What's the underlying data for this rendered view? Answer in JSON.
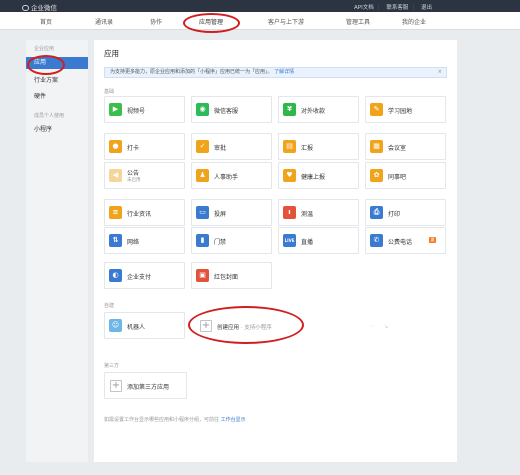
{
  "topbar": {
    "brand": "企业微信",
    "links": [
      "API文档",
      "联系客服",
      "退出"
    ]
  },
  "nav": {
    "items": [
      "首页",
      "通讯录",
      "协作",
      "应用管理",
      "客户与上下游",
      "管理工具",
      "我的企业"
    ],
    "active": "应用管理"
  },
  "sidebar": {
    "group1": "企业应用",
    "items": [
      "应用",
      "行业方案",
      "硬件"
    ],
    "group2": "成员个人使用",
    "items2": [
      "小程序"
    ]
  },
  "main": {
    "title": "应用",
    "notice": "为支持更多能力，原企业应用和添加的「小程序」应用已统一为「应用」。",
    "notice_link": "了解详情",
    "notice_close": "×",
    "basic_title": "基础",
    "apps": [
      {
        "name": "视频号",
        "color": "#3bbf4a",
        "glyph": "▶"
      },
      {
        "name": "微信客服",
        "color": "#2fba5a",
        "glyph": "◉"
      },
      {
        "name": "对外收款",
        "color": "#2fb74a",
        "glyph": "¥"
      },
      {
        "name": "学习园地",
        "color": "#f0a41c",
        "glyph": "✎"
      },
      {
        "name": "打卡",
        "color": "#f0a41c",
        "glyph": "●"
      },
      {
        "name": "审批",
        "color": "#f0a41c",
        "glyph": "✓"
      },
      {
        "name": "汇报",
        "color": "#f0a41c",
        "glyph": "▤"
      },
      {
        "name": "会议室",
        "color": "#f0a41c",
        "glyph": "▦"
      },
      {
        "name": "公告",
        "sub": "未启用",
        "color": "#f6d59a",
        "glyph": "◀"
      },
      {
        "name": "人事助手",
        "color": "#f0a41c",
        "glyph": "♟"
      },
      {
        "name": "健康上报",
        "color": "#f0a41c",
        "glyph": "♥"
      },
      {
        "name": "同事吧",
        "color": "#f0a41c",
        "glyph": "✿"
      },
      {
        "name": "行业资讯",
        "color": "#f0a41c",
        "glyph": "≡"
      },
      {
        "name": "投屏",
        "color": "#3a7ad0",
        "glyph": "▭"
      },
      {
        "name": "测温",
        "color": "#e3533b",
        "glyph": "ı"
      },
      {
        "name": "打印",
        "color": "#3a7ad0",
        "glyph": "⎙"
      },
      {
        "name": "网络",
        "color": "#3a7ad0",
        "glyph": "⇅"
      },
      {
        "name": "门禁",
        "color": "#3a7ad0",
        "glyph": "▮"
      },
      {
        "name": "直播",
        "color": "#3a7ad0",
        "glyph": "LIVE"
      },
      {
        "name": "公费电话",
        "color": "#3a7ad0",
        "glyph": "✆",
        "badge": "惠"
      },
      {
        "name": "企业支付",
        "color": "#3a7ad0",
        "glyph": "◐"
      },
      {
        "name": "红包封面",
        "color": "#e3533b",
        "glyph": "▣"
      }
    ],
    "custom_title": "自建",
    "robot": "机器人",
    "create_app": "创建应用",
    "create_note": " · 支持小程序",
    "third_title": "第三方",
    "add_third": "添加第三方应用",
    "footer": "如需设置工作台显示哪些应用和小程序分组，可前往",
    "footer_link": "工作台显示",
    "misc": [
      "◦",
      "↘"
    ]
  },
  "colors": {
    "topbar": "#2b3440",
    "accent": "#3a7ad0",
    "annotation": "#d01f1f"
  }
}
